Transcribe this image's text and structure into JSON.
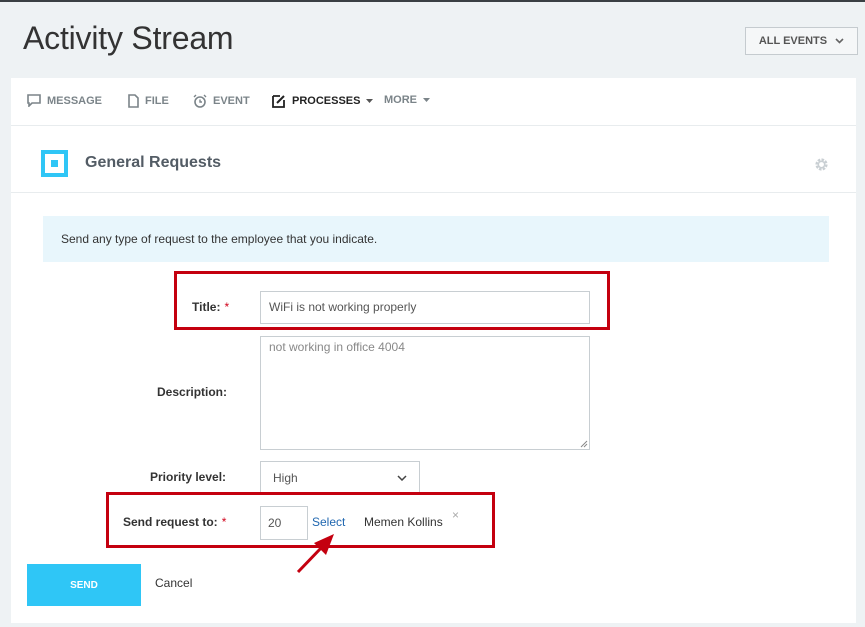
{
  "header": {
    "title": "Activity Stream",
    "all_events_label": "ALL EVENTS"
  },
  "tabs": [
    {
      "label": "MESSAGE",
      "icon": "message-icon"
    },
    {
      "label": "FILE",
      "icon": "file-icon"
    },
    {
      "label": "EVENT",
      "icon": "alarm-icon"
    },
    {
      "label": "PROCESSES",
      "icon": "edit-icon",
      "active": true
    },
    {
      "label": "MORE"
    }
  ],
  "request": {
    "title": "General Requests",
    "info": "Send any type of request to the employee that you indicate.",
    "title_label": "Title:",
    "title_value": "WiFi is not working properly",
    "description_label": "Description:",
    "description_value": "not working in office 4004",
    "priority_label": "Priority level:",
    "priority_value": "High",
    "send_to_label": "Send request to:",
    "send_to_value": "20",
    "select_label": "Select",
    "person_name": "Memen Kollins",
    "remove_symbol": "×",
    "required_mark": "*"
  },
  "footer": {
    "send_label": "SEND",
    "cancel_label": "Cancel"
  },
  "colors": {
    "accent": "#2fc6f6",
    "highlight": "#c4000f",
    "link": "#2067b0"
  }
}
